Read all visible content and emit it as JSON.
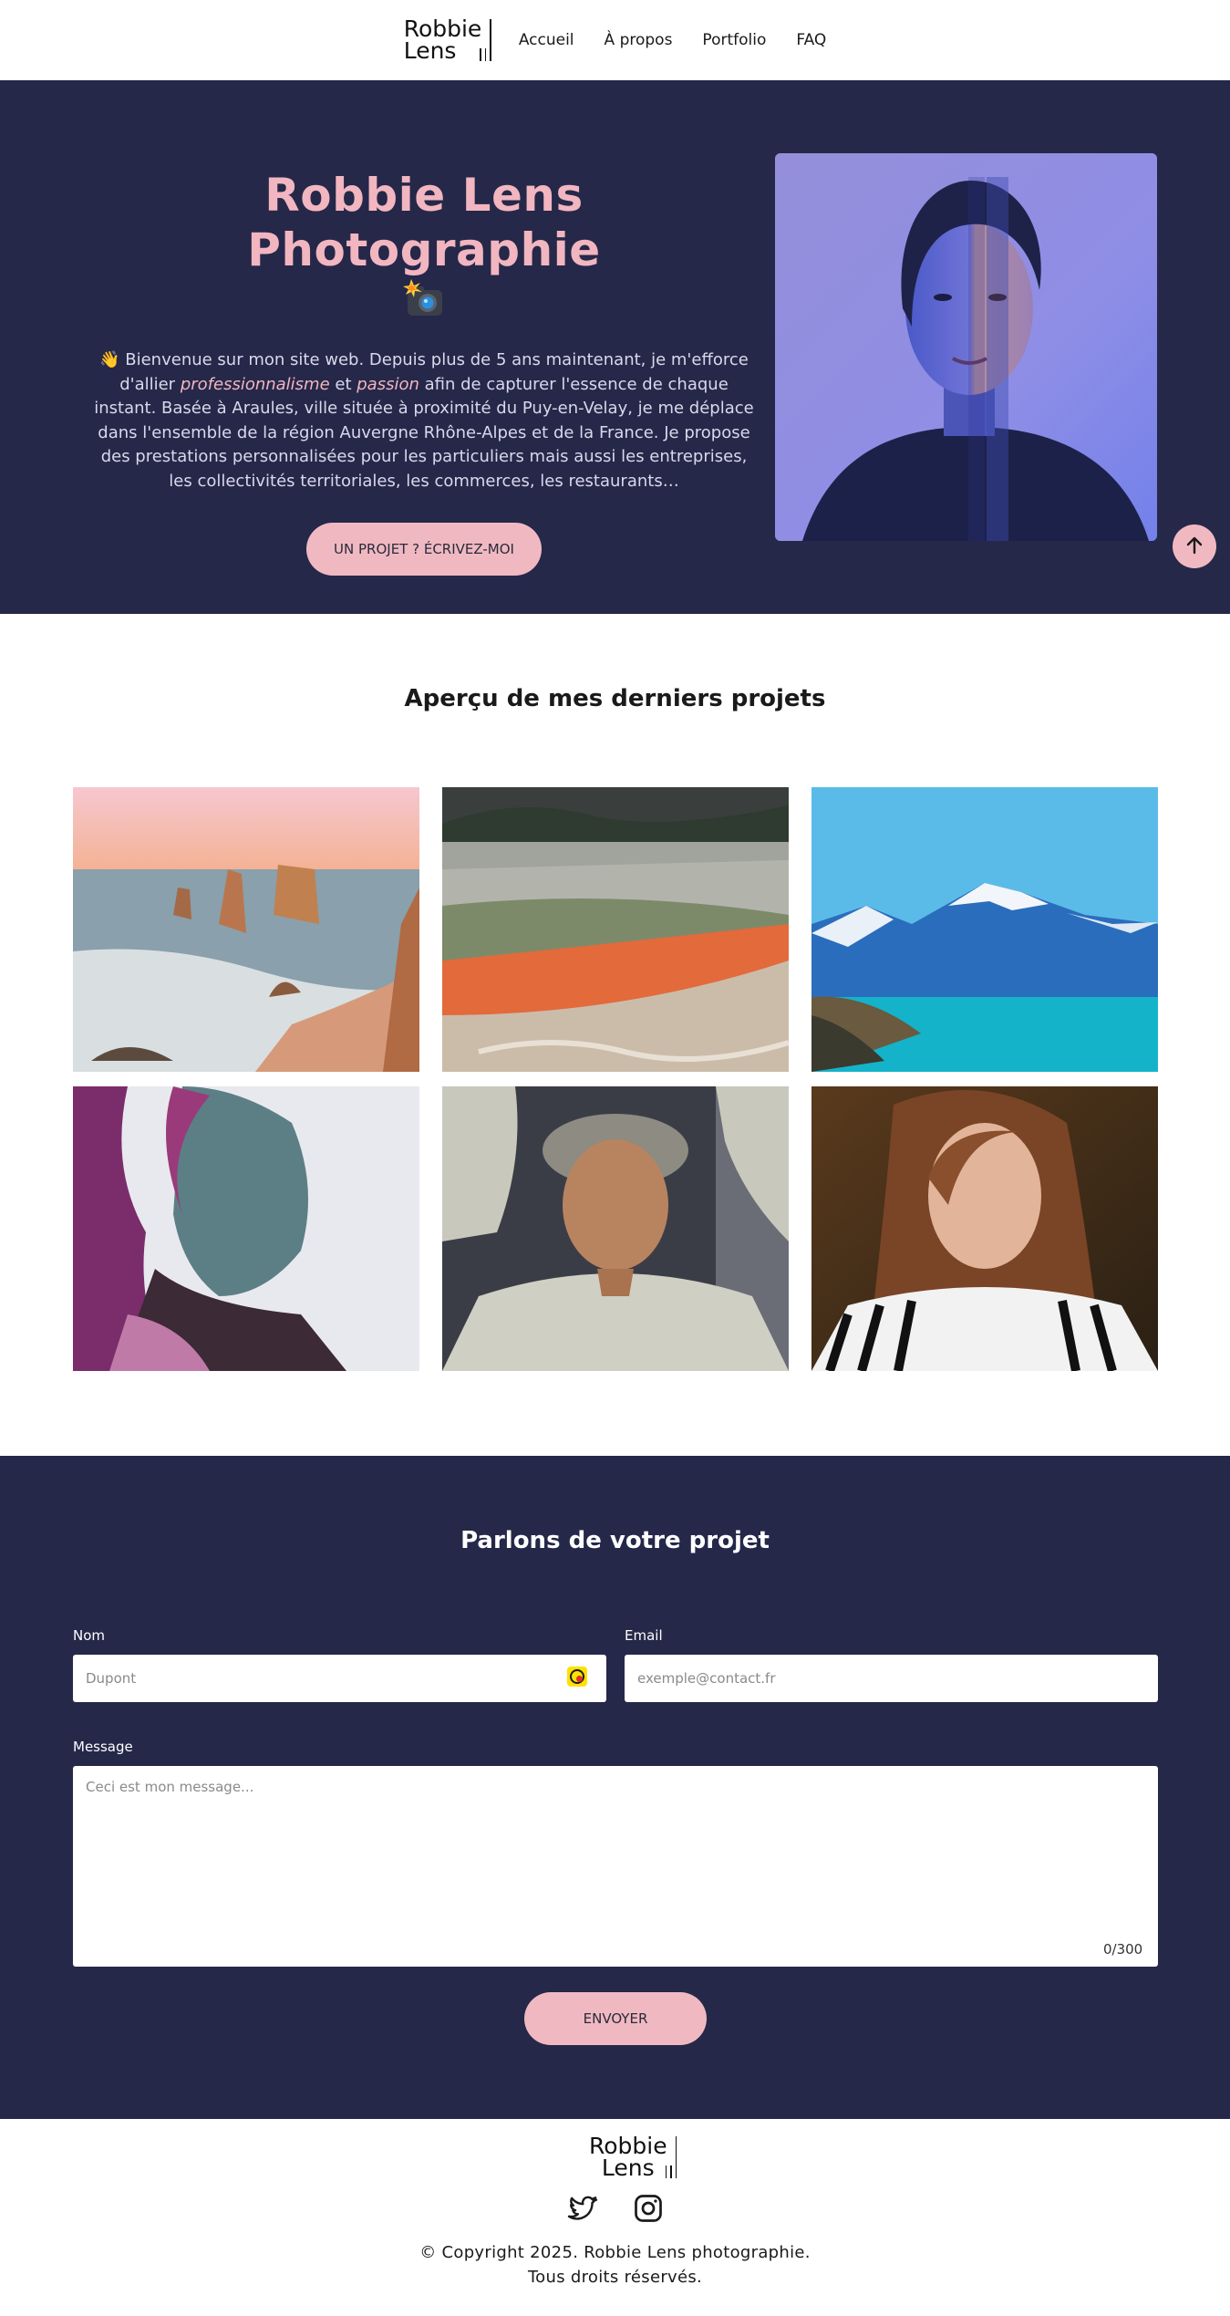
{
  "header": {
    "logo": {
      "line1": "Robbie",
      "line2": "Lens"
    },
    "nav": [
      "Accueil",
      "À propos",
      "Portfolio",
      "FAQ"
    ]
  },
  "hero": {
    "title": "Robbie Lens Photographie",
    "emoji_icon": "camera-with-flash",
    "intro_parts": [
      "👋 Bienvenue sur mon site web. Depuis plus de 5 ans maintenant, je m'efforce d'allier ",
      "professionnalisme",
      " et ",
      "passion",
      " afin de capturer l'essence de chaque instant. Basée à Araules, ville située à proximité du Puy-en-Velay, je me déplace dans l'ensemble de la région Auvergne Rhône-Alpes et de la France. Je propose des prestations personnalisées pour les particuliers mais aussi les entreprises, les collectivités territoriales, les commerces, les restaurants…"
    ],
    "cta": "UN PROJET ? ÉCRIVEZ-MOI",
    "photo_alt": "portrait-woman-blue-light",
    "scroll_top_icon": "arrow-up-icon"
  },
  "projects": {
    "title": "Aperçu de mes derniers projets",
    "items": [
      {
        "name": "coastal-rock-stacks-photo"
      },
      {
        "name": "hot-spring-steam-photo"
      },
      {
        "name": "mountain-lake-photo"
      },
      {
        "name": "woman-purple-portrait-photo"
      },
      {
        "name": "man-bucket-hat-portrait-photo"
      },
      {
        "name": "woman-striped-shirt-portrait-photo"
      }
    ]
  },
  "contact": {
    "title": "Parlons de votre projet",
    "name_label": "Nom",
    "name_placeholder": "Dupont",
    "email_label": "Email",
    "email_placeholder": "exemple@contact.fr",
    "message_label": "Message",
    "message_placeholder": "Ceci est mon message...",
    "counter": "0/300",
    "submit": "ENVOYER"
  },
  "footer": {
    "logo": {
      "line1": "Robbie",
      "line2": "Lens"
    },
    "social": [
      "twitter-icon",
      "instagram-icon"
    ],
    "copyright_line1": "© Copyright 2025. Robbie Lens photographie.",
    "copyright_line2": "Tous droits réservés."
  },
  "colors": {
    "navy": "#252849",
    "pink": "#f0b9c2",
    "title_pink": "#f2b6c0"
  }
}
